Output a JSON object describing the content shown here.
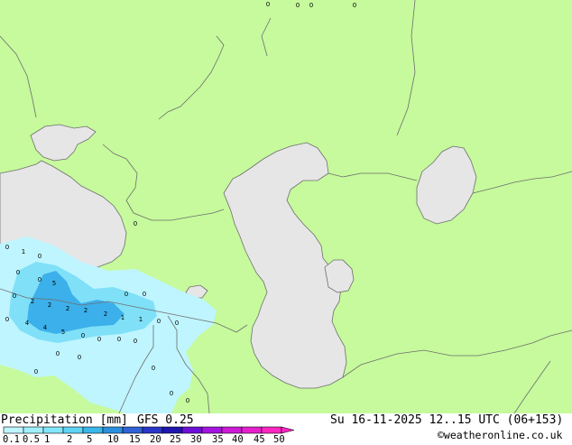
{
  "title": "Precipitation [mm]",
  "model": "GFS 0.25",
  "valid_time": "Su 16-11-2025 12..15 UTC (06+153)",
  "copyright": "©weatheronline.co.uk",
  "legend": {
    "labels": [
      "0.1",
      "0.5",
      "1",
      "2",
      "5",
      "10",
      "15",
      "20",
      "25",
      "30",
      "35",
      "40",
      "45",
      "50"
    ],
    "colors": [
      "#bff5ff",
      "#a0f0ff",
      "#80e7fb",
      "#5fd4f5",
      "#3ab6ea",
      "#2b8fe0",
      "#2f62d6",
      "#2a35c7",
      "#1f16b0",
      "#6e0fd9",
      "#a314e0",
      "#cc1ad6",
      "#e61fcc",
      "#ff26c2"
    ]
  },
  "colors": {
    "land": "#c6fa9c",
    "sea": "#e6e6e6",
    "border": "#6e6e6e",
    "precip_light": "#bff5ff",
    "precip_mid": "#7fe0f8",
    "precip_heavy": "#3cb0ea"
  },
  "precip_values": [
    "0",
    "0",
    "0",
    "0",
    "0",
    "1",
    "0",
    "0",
    "0",
    "5",
    "0",
    "2",
    "2",
    "2",
    "2",
    "2",
    "1",
    "0",
    "4",
    "4",
    "5",
    "1",
    "0",
    "0",
    "0",
    "0",
    "0",
    "0",
    "0",
    "0",
    "0",
    "0",
    "0",
    "0",
    "0",
    "0",
    "0"
  ]
}
